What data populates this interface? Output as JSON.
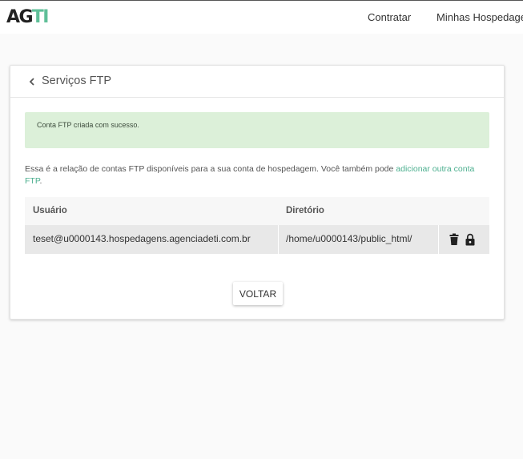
{
  "brand": {
    "logo_dark": "AG",
    "logo_accent": "TI",
    "accent_color": "#5fbf98"
  },
  "nav": {
    "contratar": "Contratar",
    "minhas": "Minhas Hospedagens"
  },
  "card": {
    "title": "Serviços FTP",
    "alert": "Conta FTP criada com sucesso.",
    "description_prefix": "Essa é a relação de contas FTP disponíveis para a sua conta de hospedagem. Você também pode ",
    "description_link": "adicionar outra conta FTP",
    "description_suffix": ".",
    "table": {
      "headers": {
        "user": "Usuário",
        "directory": "Diretório"
      },
      "rows": [
        {
          "user": "teset@u0000143.hospedagens.agenciadeti.com.br",
          "directory": "/home/u0000143/public_html/"
        }
      ]
    },
    "back_button": "VOLTAR"
  }
}
